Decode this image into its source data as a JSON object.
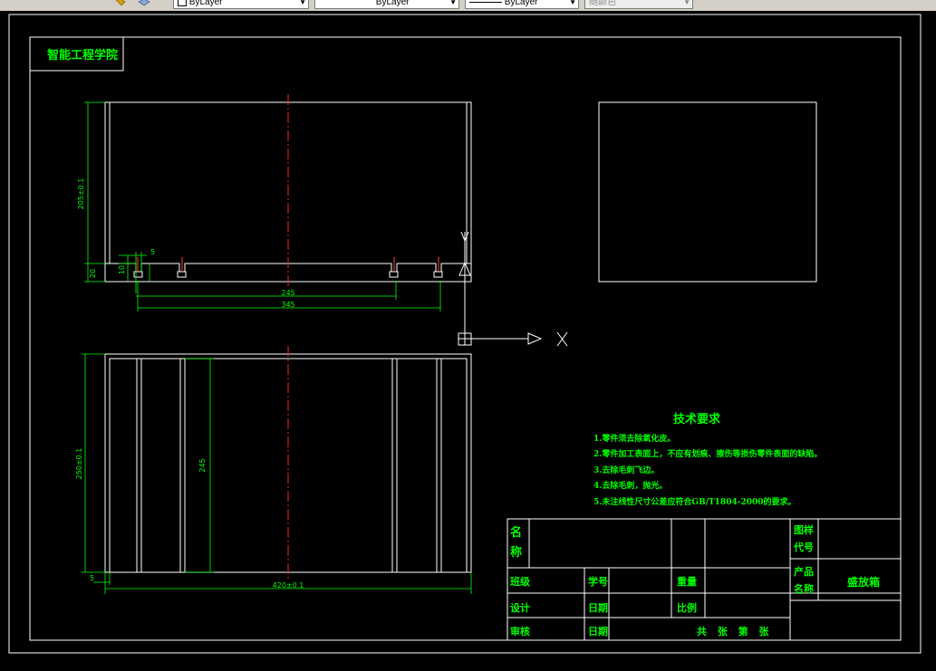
{
  "toolbar": {
    "layer_select": "ByLayer",
    "linetype_select": "ByLayer",
    "lineweight_select": "ByLayer",
    "plotstyle_select": "随颜色"
  },
  "drawing": {
    "school_label": "智能工程学院",
    "dims": {
      "height_top": "205±0.1",
      "d20": "20",
      "d10": "10",
      "d5a": "5",
      "d245": "245",
      "d345": "345",
      "height_bottom": "250±0.1",
      "d245v": "245",
      "d5b": "5",
      "width": "420±0.1"
    },
    "axis_x_label": "X"
  },
  "tech": {
    "title": "技术要求",
    "items": [
      "1.零件须去除氧化皮。",
      "2.零件加工表面上，不应有划痕、擦伤等损伤零件表面的缺陷。",
      "3.去除毛刺飞边。",
      "4.去除毛刺，抛光。",
      "5.未注线性尺寸公差应符合GB/T1804-2000的要求。"
    ]
  },
  "title_block": {
    "name_label": "名 称",
    "drawing_no_label": "图样 代号",
    "class_label": "班级",
    "student_no_label": "学号",
    "weight_label": "重量",
    "product_label": "产品 名称",
    "product_name": "盛放箱",
    "design_label": "设计",
    "date1_label": "日期",
    "scale_label": "比例",
    "review_label": "审核",
    "date2_label": "日期",
    "sheets_label": "共 张 第 张"
  }
}
